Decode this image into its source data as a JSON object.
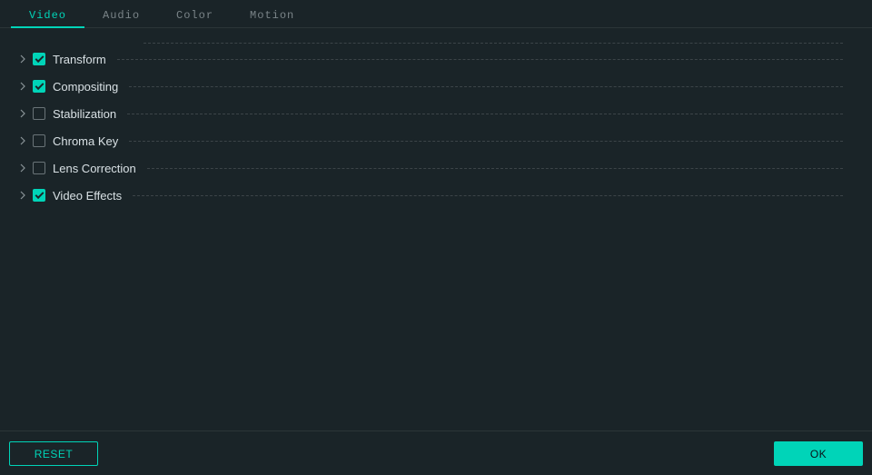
{
  "tabs": [
    {
      "label": "Video",
      "active": true
    },
    {
      "label": "Audio",
      "active": false
    },
    {
      "label": "Color",
      "active": false
    },
    {
      "label": "Motion",
      "active": false
    }
  ],
  "rows": [
    {
      "label": "Transform",
      "checked": true
    },
    {
      "label": "Compositing",
      "checked": true
    },
    {
      "label": "Stabilization",
      "checked": false
    },
    {
      "label": "Chroma Key",
      "checked": false
    },
    {
      "label": "Lens Correction",
      "checked": false
    },
    {
      "label": "Video Effects",
      "checked": true
    }
  ],
  "footer": {
    "reset_label": "RESET",
    "ok_label": "OK"
  }
}
